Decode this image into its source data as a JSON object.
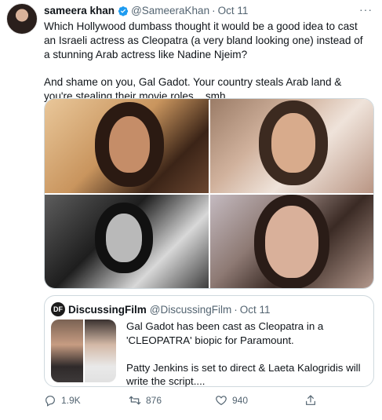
{
  "tweet": {
    "display_name": "sameera khan",
    "handle": "@SameeraKhan",
    "separator": "·",
    "date": "Oct 11",
    "text_lines": [
      "Which Hollywood dumbass thought it would be a good idea to cast an Israeli actress as Cleopatra (a very bland looking one) instead of a stunning Arab actress like Nadine Njeim?",
      "And shame on you, Gal Gadot. Your country steals Arab land & you're stealing their movie roles... smh."
    ]
  },
  "quoted_tweet": {
    "avatar_text": "DF",
    "display_name": "DiscussingFilm",
    "handle": "@DiscussingFilm",
    "separator": "·",
    "date": "Oct 11",
    "text_lines": [
      "Gal Gadot has been cast as Cleopatra in a 'CLEOPATRA' biopic for Paramount.",
      "Patty Jenkins is set to direct & Laeta Kalogridis will write the script...."
    ]
  },
  "actions": {
    "reply_count": "1.9K",
    "retweet_count": "876",
    "like_count": "940"
  },
  "colors": {
    "verified": "#1d9bf0",
    "muted_text": "#536471",
    "border": "#cfd9de"
  },
  "icons": {
    "more": "more-horizontal-icon",
    "verified": "verified-badge-icon",
    "reply": "reply-icon",
    "retweet": "retweet-icon",
    "like": "heart-icon",
    "share": "share-icon"
  }
}
